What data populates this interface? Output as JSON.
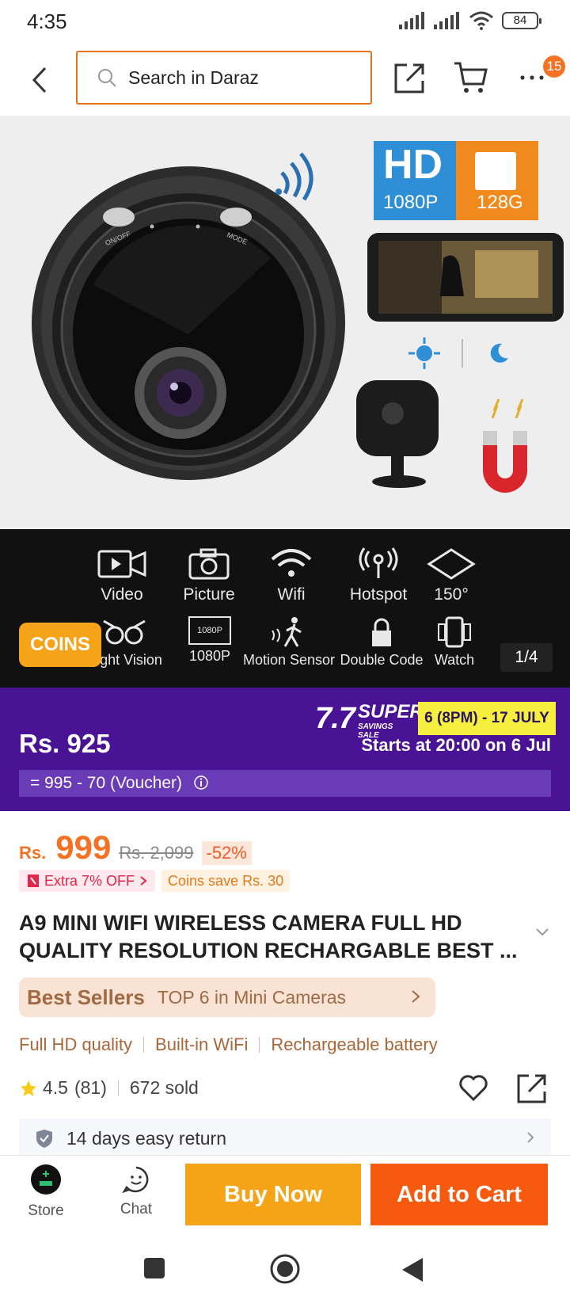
{
  "status_bar": {
    "time": "4:35",
    "battery": "84"
  },
  "topbar": {
    "search_placeholder": "Search in Daraz",
    "cart_badge": "15"
  },
  "gallery": {
    "hd_label": "HD",
    "resolution_label": "1080P",
    "storage_label": "128G",
    "button_on_off": "ON/OFF",
    "button_mode": "MODE",
    "features": [
      {
        "label": "Video",
        "icon": "video-camera-icon"
      },
      {
        "label": "Picture",
        "icon": "camera-icon"
      },
      {
        "label": "Wifi",
        "icon": "wifi-icon"
      },
      {
        "label": "Hotspot",
        "icon": "hotspot-icon"
      },
      {
        "label": "150°",
        "icon": "angle-icon"
      },
      {
        "label": "Night Vision",
        "icon": "owl-eyes-icon"
      },
      {
        "label": "1080P",
        "icon": "hd-screen-icon"
      },
      {
        "label": "Motion Sensor",
        "icon": "motion-icon"
      },
      {
        "label": "Double Code",
        "icon": "lock-icon"
      },
      {
        "label": "Watch",
        "icon": "phone-icon"
      }
    ],
    "screen_1080p": "1080P",
    "coins": "COINS",
    "counter": "1/4"
  },
  "promo": {
    "price": "Rs. 925",
    "sale_number": "7.7",
    "sale_super": "SUPER",
    "sale_sub": "SAVINGS SALE",
    "date_chip": "6 (8PM) - 17 JULY",
    "starts": "Starts at 20:00 on 6 Jul",
    "voucher_calc": "= 995 - 70 (Voucher)"
  },
  "product": {
    "currency": "Rs.",
    "price": "999",
    "original_price": "Rs. 2,099",
    "discount": "-52%",
    "extra_off": "Extra 7% OFF",
    "coins_save": "Coins save Rs. 30",
    "title": "A9 MINI WIFI WIRELESS CAMERA FULL HD QUALITY RESOLUTION RECHARGABLE BEST ...",
    "best_sellers": "Best Sellers",
    "best_rank": "TOP 6 in Mini Cameras",
    "highlights": [
      "Full HD quality",
      "Built-in WiFi",
      "Rechargeable battery"
    ],
    "rating": "4.5",
    "reviews": "(81)",
    "sold": "672 sold",
    "return_policy": "14 days easy return"
  },
  "actions": {
    "store": "Store",
    "chat": "Chat",
    "buy_now": "Buy Now",
    "add_to_cart": "Add to Cart"
  },
  "colors": {
    "accent": "#f57224",
    "promo_bg": "#4a1396",
    "buy_now": "#f5a418",
    "add_to_cart": "#f55a0f"
  }
}
